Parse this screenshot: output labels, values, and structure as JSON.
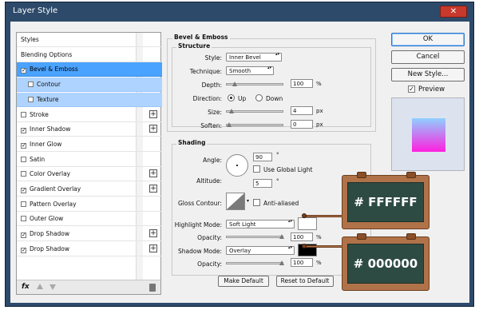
{
  "window": {
    "title": "Layer Style",
    "close": "✕"
  },
  "styles_list": {
    "items": [
      {
        "label": "Styles",
        "checkbox": false,
        "checked": false,
        "plus": false,
        "state": "normal"
      },
      {
        "label": "Blending Options",
        "checkbox": false,
        "checked": false,
        "plus": false,
        "state": "normal"
      },
      {
        "label": "Bevel & Emboss",
        "checkbox": true,
        "checked": true,
        "plus": false,
        "state": "selected"
      },
      {
        "label": "Contour",
        "checkbox": true,
        "checked": false,
        "plus": false,
        "state": "sub"
      },
      {
        "label": "Texture",
        "checkbox": true,
        "checked": false,
        "plus": false,
        "state": "sub"
      },
      {
        "label": "Stroke",
        "checkbox": true,
        "checked": false,
        "plus": true,
        "state": "normal"
      },
      {
        "label": "Inner Shadow",
        "checkbox": true,
        "checked": true,
        "plus": true,
        "state": "normal"
      },
      {
        "label": "Inner Glow",
        "checkbox": true,
        "checked": true,
        "plus": false,
        "state": "normal"
      },
      {
        "label": "Satin",
        "checkbox": true,
        "checked": false,
        "plus": false,
        "state": "normal"
      },
      {
        "label": "Color Overlay",
        "checkbox": true,
        "checked": false,
        "plus": true,
        "state": "normal"
      },
      {
        "label": "Gradient Overlay",
        "checkbox": true,
        "checked": true,
        "plus": true,
        "state": "normal"
      },
      {
        "label": "Pattern Overlay",
        "checkbox": true,
        "checked": false,
        "plus": false,
        "state": "normal"
      },
      {
        "label": "Outer Glow",
        "checkbox": true,
        "checked": false,
        "plus": false,
        "state": "normal"
      },
      {
        "label": "Drop Shadow",
        "checkbox": true,
        "checked": true,
        "plus": true,
        "state": "normal"
      },
      {
        "label": "Drop Shadow",
        "checkbox": true,
        "checked": true,
        "plus": true,
        "state": "normal"
      }
    ],
    "fx_label": "fx"
  },
  "bevel": {
    "title": "Bevel & Emboss",
    "structure_title": "Structure",
    "style_label": "Style:",
    "style_value": "Inner Bevel",
    "technique_label": "Technique:",
    "technique_value": "Smooth",
    "depth_label": "Depth:",
    "depth_value": "100",
    "depth_unit": "%",
    "depth_fraction": 0.1,
    "direction_label": "Direction:",
    "direction_up": "Up",
    "direction_down": "Down",
    "size_label": "Size:",
    "size_value": "4",
    "size_unit": "px",
    "size_fraction": 0.05,
    "soften_label": "Soften:",
    "soften_value": "0",
    "soften_unit": "px",
    "soften_fraction": 0.0
  },
  "shading": {
    "title": "Shading",
    "angle_label": "Angle:",
    "angle_value": "90",
    "angle_unit": "°",
    "global_light_label": "Use Global Light",
    "altitude_label": "Altitude:",
    "altitude_value": "5",
    "altitude_unit": "°",
    "gloss_label": "Gloss Contour:",
    "anti_aliased_label": "Anti-aliased",
    "highlight_mode_label": "Highlight Mode:",
    "highlight_mode_value": "Soft Light",
    "highlight_color": "#FFFFFF",
    "highlight_opacity_label": "Opacity:",
    "highlight_opacity_value": "100",
    "highlight_opacity_unit": "%",
    "shadow_mode_label": "Shadow Mode:",
    "shadow_mode_value": "Overlay",
    "shadow_color": "#000000",
    "shadow_opacity_label": "Opacity:",
    "shadow_opacity_value": "100",
    "shadow_opacity_unit": "%"
  },
  "footer": {
    "make_default": "Make Default",
    "reset_default": "Reset to Default"
  },
  "right": {
    "ok": "OK",
    "cancel": "Cancel",
    "new_style": "New Style...",
    "preview_label": "Preview",
    "preview_gradient_top": "#8fd0ff",
    "preview_gradient_bottom": "#ff1fe0"
  },
  "callouts": {
    "highlight_text": "# FFFFFF",
    "shadow_text": "# 000000"
  }
}
